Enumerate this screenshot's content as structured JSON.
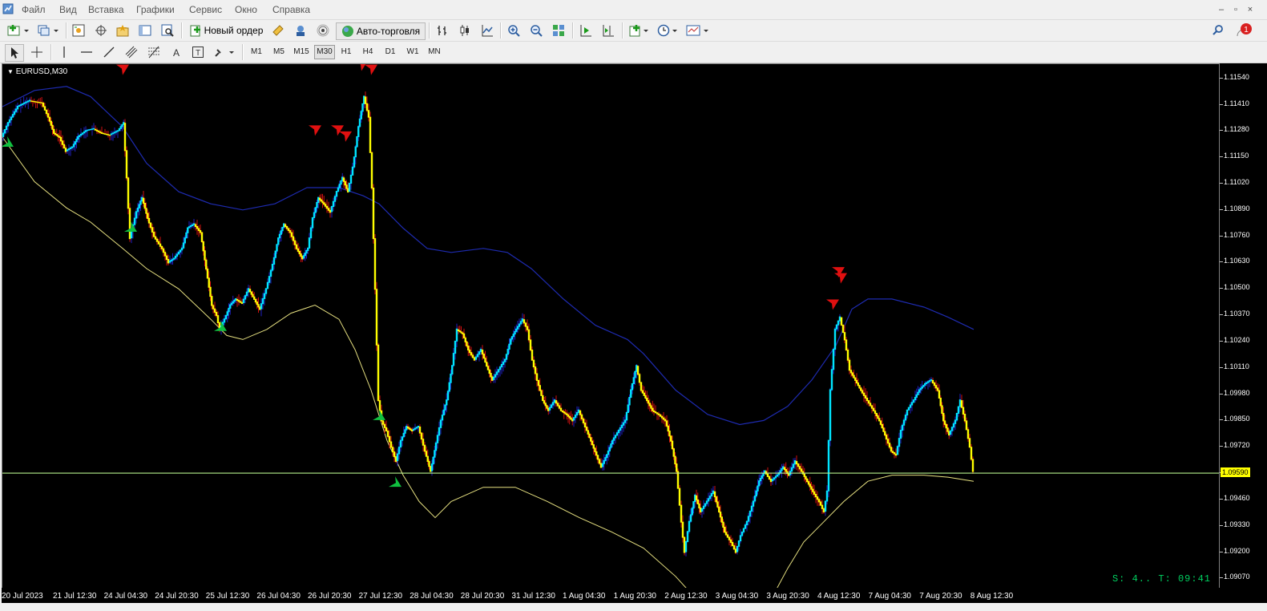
{
  "menu": [
    "Файл",
    "Вид",
    "Вставка",
    "Графики",
    "Сервис",
    "Окно",
    "Справка"
  ],
  "toolbar": {
    "new_order": "Новый ордер",
    "autotrading": "Авто-торговля"
  },
  "timeframes": [
    "M1",
    "M5",
    "M15",
    "M30",
    "H1",
    "H4",
    "D1",
    "W1",
    "MN"
  ],
  "active_timeframe": "M30",
  "chart": {
    "symbol_label": "EURUSD,M30",
    "current_price": "1.09590",
    "timer_text": "S: 4.. T: 09:41",
    "price_ticks": [
      "1.11540",
      "1.11410",
      "1.11280",
      "1.11150",
      "1.11020",
      "1.10890",
      "1.10760",
      "1.10630",
      "1.10500",
      "1.10370",
      "1.10240",
      "1.10110",
      "1.09980",
      "1.09850",
      "1.09720",
      "1.09590",
      "1.09460",
      "1.09330",
      "1.09200",
      "1.09070"
    ],
    "time_ticks": [
      "20 Jul 2023",
      "21 Jul 12:30",
      "24 Jul 04:30",
      "24 Jul 20:30",
      "25 Jul 12:30",
      "26 Jul 04:30",
      "26 Jul 20:30",
      "27 Jul 12:30",
      "28 Jul 04:30",
      "28 Jul 20:30",
      "31 Jul 12:30",
      "1 Aug 04:30",
      "1 Aug 20:30",
      "2 Aug 12:30",
      "3 Aug 04:30",
      "3 Aug 20:30",
      "4 Aug 12:30",
      "7 Aug 04:30",
      "7 Aug 20:30",
      "8 Aug 12:30"
    ],
    "colors": {
      "background": "#000000",
      "bull": "#00e5ff",
      "bear": "#ffff00",
      "wick_up": "#2020c0",
      "wick_down": "#d01010",
      "upper_band": "#1e2bb0",
      "lower_band": "#e6e080",
      "price_line": "#b6f08c",
      "sell_arrow": "#e01010",
      "buy_arrow": "#10c040"
    }
  },
  "chart_data": {
    "type": "line",
    "series_close": [
      [
        0,
        1.1125
      ],
      [
        8,
        1.1132
      ],
      [
        20,
        1.114
      ],
      [
        35,
        1.1143
      ],
      [
        50,
        1.1142
      ],
      [
        58,
        1.1135
      ],
      [
        65,
        1.1127
      ],
      [
        72,
        1.1125
      ],
      [
        80,
        1.1118
      ],
      [
        88,
        1.112
      ],
      [
        95,
        1.1125
      ],
      [
        105,
        1.1128
      ],
      [
        115,
        1.1129
      ],
      [
        125,
        1.1127
      ],
      [
        135,
        1.1126
      ],
      [
        145,
        1.1128
      ],
      [
        152,
        1.1132
      ],
      [
        156,
        1.1105
      ],
      [
        160,
        1.1075
      ],
      [
        168,
        1.1088
      ],
      [
        175,
        1.1095
      ],
      [
        182,
        1.1085
      ],
      [
        190,
        1.1076
      ],
      [
        200,
        1.107
      ],
      [
        208,
        1.1063
      ],
      [
        215,
        1.1065
      ],
      [
        225,
        1.107
      ],
      [
        232,
        1.108
      ],
      [
        240,
        1.1082
      ],
      [
        248,
        1.1078
      ],
      [
        255,
        1.106
      ],
      [
        262,
        1.1042
      ],
      [
        268,
        1.1037
      ],
      [
        272,
        1.103
      ],
      [
        278,
        1.1035
      ],
      [
        285,
        1.1042
      ],
      [
        292,
        1.1045
      ],
      [
        300,
        1.1043
      ],
      [
        308,
        1.105
      ],
      [
        315,
        1.1045
      ],
      [
        322,
        1.104
      ],
      [
        330,
        1.105
      ],
      [
        338,
        1.1062
      ],
      [
        345,
        1.1075
      ],
      [
        352,
        1.1082
      ],
      [
        360,
        1.1078
      ],
      [
        368,
        1.107
      ],
      [
        375,
        1.1065
      ],
      [
        382,
        1.107
      ],
      [
        388,
        1.1085
      ],
      [
        395,
        1.1095
      ],
      [
        402,
        1.1092
      ],
      [
        410,
        1.1088
      ],
      [
        418,
        1.1098
      ],
      [
        425,
        1.1105
      ],
      [
        432,
        1.1098
      ],
      [
        438,
        1.111
      ],
      [
        445,
        1.113
      ],
      [
        452,
        1.1145
      ],
      [
        458,
        1.1135
      ],
      [
        462,
        1.11
      ],
      [
        466,
        1.105
      ],
      [
        470,
        1.0995
      ],
      [
        474,
        1.0985
      ],
      [
        480,
        1.098
      ],
      [
        486,
        1.0972
      ],
      [
        492,
        1.0965
      ],
      [
        498,
        1.0975
      ],
      [
        505,
        1.0982
      ],
      [
        512,
        1.098
      ],
      [
        520,
        1.0982
      ],
      [
        528,
        1.097
      ],
      [
        535,
        1.096
      ],
      [
        540,
        1.097
      ],
      [
        548,
        1.0985
      ],
      [
        555,
        1.0995
      ],
      [
        562,
        1.1012
      ],
      [
        568,
        1.103
      ],
      [
        575,
        1.1028
      ],
      [
        582,
        1.102
      ],
      [
        590,
        1.1015
      ],
      [
        598,
        1.102
      ],
      [
        605,
        1.1012
      ],
      [
        612,
        1.1005
      ],
      [
        620,
        1.101
      ],
      [
        628,
        1.1015
      ],
      [
        635,
        1.1025
      ],
      [
        642,
        1.103
      ],
      [
        650,
        1.1035
      ],
      [
        656,
        1.103
      ],
      [
        662,
        1.1015
      ],
      [
        668,
        1.1005
      ],
      [
        675,
        1.0995
      ],
      [
        682,
        1.099
      ],
      [
        690,
        1.0995
      ],
      [
        698,
        1.099
      ],
      [
        705,
        1.0988
      ],
      [
        712,
        1.0985
      ],
      [
        720,
        1.099
      ],
      [
        728,
        1.0982
      ],
      [
        735,
        1.0975
      ],
      [
        742,
        1.0968
      ],
      [
        748,
        1.0962
      ],
      [
        755,
        1.0968
      ],
      [
        762,
        1.0975
      ],
      [
        770,
        1.098
      ],
      [
        778,
        1.0985
      ],
      [
        785,
        1.1
      ],
      [
        792,
        1.1012
      ],
      [
        798,
        1.1
      ],
      [
        805,
        1.0995
      ],
      [
        812,
        1.099
      ],
      [
        820,
        1.0988
      ],
      [
        828,
        1.0985
      ],
      [
        835,
        1.0975
      ],
      [
        842,
        1.096
      ],
      [
        848,
        1.0935
      ],
      [
        852,
        1.092
      ],
      [
        858,
        1.0935
      ],
      [
        865,
        1.0948
      ],
      [
        872,
        1.094
      ],
      [
        880,
        1.0945
      ],
      [
        888,
        1.095
      ],
      [
        895,
        1.094
      ],
      [
        902,
        1.093
      ],
      [
        910,
        1.0925
      ],
      [
        916,
        1.092
      ],
      [
        922,
        1.0928
      ],
      [
        930,
        1.0935
      ],
      [
        938,
        1.0945
      ],
      [
        945,
        1.0955
      ],
      [
        952,
        1.096
      ],
      [
        960,
        1.0955
      ],
      [
        968,
        1.0958
      ],
      [
        975,
        1.0962
      ],
      [
        982,
        1.0958
      ],
      [
        990,
        1.0965
      ],
      [
        998,
        1.096
      ],
      [
        1005,
        1.0955
      ],
      [
        1012,
        1.095
      ],
      [
        1020,
        1.0945
      ],
      [
        1026,
        1.094
      ],
      [
        1030,
        1.095
      ],
      [
        1034,
        1.1
      ],
      [
        1040,
        1.103
      ],
      [
        1046,
        1.1036
      ],
      [
        1052,
        1.1025
      ],
      [
        1058,
        1.101
      ],
      [
        1065,
        1.1005
      ],
      [
        1072,
        1.1
      ],
      [
        1080,
        1.0995
      ],
      [
        1088,
        1.099
      ],
      [
        1095,
        1.0985
      ],
      [
        1102,
        1.0978
      ],
      [
        1110,
        1.097
      ],
      [
        1116,
        1.0968
      ],
      [
        1122,
        1.098
      ],
      [
        1130,
        1.099
      ],
      [
        1138,
        1.0995
      ],
      [
        1145,
        1.1
      ],
      [
        1152,
        1.1003
      ],
      [
        1160,
        1.1005
      ],
      [
        1168,
        1.1
      ],
      [
        1175,
        1.0985
      ],
      [
        1182,
        1.0978
      ],
      [
        1190,
        1.0985
      ],
      [
        1196,
        1.0995
      ],
      [
        1202,
        1.0985
      ],
      [
        1208,
        1.0972
      ],
      [
        1212,
        1.096
      ]
    ],
    "upper_band": [
      [
        0,
        1.114
      ],
      [
        40,
        1.1148
      ],
      [
        80,
        1.115
      ],
      [
        110,
        1.1145
      ],
      [
        150,
        1.113
      ],
      [
        180,
        1.1112
      ],
      [
        220,
        1.1098
      ],
      [
        260,
        1.1092
      ],
      [
        300,
        1.1089
      ],
      [
        340,
        1.1092
      ],
      [
        380,
        1.11
      ],
      [
        420,
        1.11
      ],
      [
        450,
        1.1096
      ],
      [
        470,
        1.1092
      ],
      [
        500,
        1.108
      ],
      [
        530,
        1.107
      ],
      [
        560,
        1.1068
      ],
      [
        600,
        1.107
      ],
      [
        630,
        1.1068
      ],
      [
        660,
        1.106
      ],
      [
        700,
        1.1045
      ],
      [
        740,
        1.1032
      ],
      [
        780,
        1.1025
      ],
      [
        800,
        1.1018
      ],
      [
        840,
        1.1
      ],
      [
        880,
        1.0988
      ],
      [
        920,
        1.0983
      ],
      [
        950,
        1.0985
      ],
      [
        980,
        1.0992
      ],
      [
        1010,
        1.1005
      ],
      [
        1040,
        1.1022
      ],
      [
        1060,
        1.104
      ],
      [
        1080,
        1.1045
      ],
      [
        1110,
        1.1045
      ],
      [
        1150,
        1.1041
      ],
      [
        1180,
        1.1036
      ],
      [
        1212,
        1.103
      ]
    ],
    "lower_band": [
      [
        0,
        1.1125
      ],
      [
        40,
        1.1103
      ],
      [
        80,
        1.109
      ],
      [
        110,
        1.1083
      ],
      [
        150,
        1.107
      ],
      [
        180,
        1.106
      ],
      [
        220,
        1.105
      ],
      [
        260,
        1.1035
      ],
      [
        280,
        1.1027
      ],
      [
        300,
        1.1025
      ],
      [
        330,
        1.103
      ],
      [
        360,
        1.1038
      ],
      [
        390,
        1.1042
      ],
      [
        420,
        1.1035
      ],
      [
        440,
        1.102
      ],
      [
        460,
        1.1
      ],
      [
        480,
        1.0975
      ],
      [
        500,
        1.0958
      ],
      [
        520,
        1.0945
      ],
      [
        540,
        1.0937
      ],
      [
        560,
        1.0945
      ],
      [
        600,
        1.0952
      ],
      [
        640,
        1.0952
      ],
      [
        680,
        1.0945
      ],
      [
        720,
        1.0937
      ],
      [
        760,
        1.093
      ],
      [
        800,
        1.0922
      ],
      [
        840,
        1.0908
      ],
      [
        870,
        1.0895
      ],
      [
        890,
        1.0888
      ],
      [
        920,
        1.0885
      ],
      [
        950,
        1.089
      ],
      [
        980,
        1.0912
      ],
      [
        1000,
        1.0925
      ],
      [
        1025,
        1.0935
      ],
      [
        1050,
        1.0945
      ],
      [
        1080,
        1.0955
      ],
      [
        1110,
        1.0958
      ],
      [
        1150,
        1.0958
      ],
      [
        1180,
        1.0957
      ],
      [
        1212,
        1.0955
      ]
    ],
    "sell_signals": [
      [
        150,
        1.1158
      ],
      [
        448,
        1.116
      ],
      [
        452,
        1.1163
      ],
      [
        460,
        1.1158
      ],
      [
        390,
        1.1128
      ],
      [
        418,
        1.1128
      ],
      [
        428,
        1.1125
      ],
      [
        1043,
        1.1058
      ],
      [
        1046,
        1.1055
      ],
      [
        1036,
        1.1042
      ]
    ],
    "buy_signals": [
      [
        6,
        1.1123
      ],
      [
        160,
        1.1081
      ],
      [
        272,
        1.1032
      ],
      [
        470,
        1.0988
      ],
      [
        490,
        1.0955
      ]
    ],
    "ylim": [
      1.0902,
      1.1161
    ],
    "xlim": [
      0,
      1520
    ]
  }
}
